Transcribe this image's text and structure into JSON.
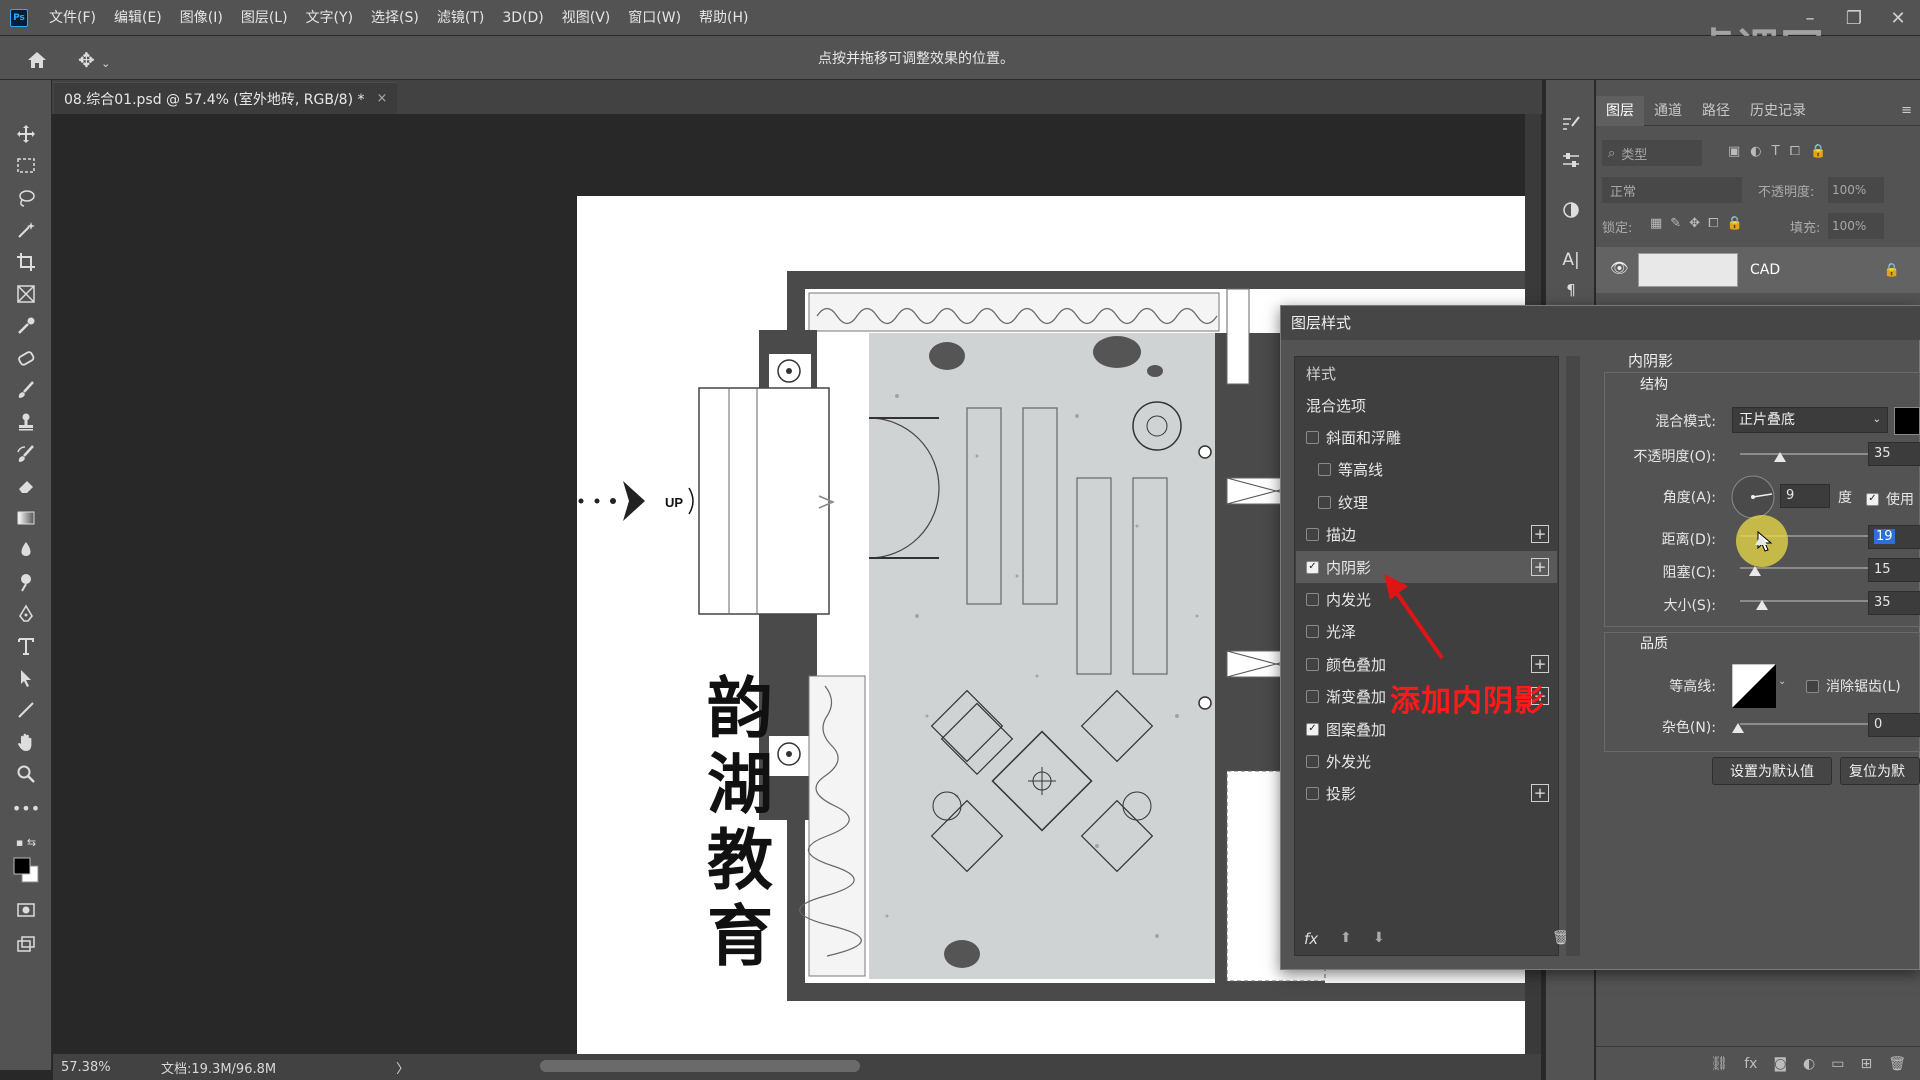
{
  "app": {
    "logo": "Ps"
  },
  "menu": [
    "文件(F)",
    "编辑(E)",
    "图像(I)",
    "图层(L)",
    "文字(Y)",
    "选择(S)",
    "滤镜(T)",
    "3D(D)",
    "视图(V)",
    "窗口(W)",
    "帮助(H)"
  ],
  "watermark": "虎课网",
  "options_bar": {
    "hint": "点按并拖移可调整效果的位置。"
  },
  "document": {
    "tab_title": "08.综合01.psd @ 57.4% (室外地砖, RGB/8) *",
    "close": "×"
  },
  "canvas": {
    "brand_text": "韵湖教育",
    "up_label": "UP"
  },
  "status": {
    "zoom": "57.38%",
    "doc_size": "文档:19.3M/96.8M",
    "arrow": "〉"
  },
  "layers_panel": {
    "tabs": [
      "图层",
      "通道",
      "路径",
      "历史记录"
    ],
    "active_tab": "图层",
    "filter_placeholder": "类型",
    "blend_mode": "正常",
    "opacity_label": "不透明度:",
    "opacity_value": "100%",
    "lock_label": "锁定:",
    "fill_label": "填充:",
    "fill_value": "100%",
    "layer_name": "CAD"
  },
  "dialog": {
    "title": "图层样式",
    "styles_header": "样式",
    "blend_options": "混合选项",
    "items": [
      {
        "label": "斜面和浮雕",
        "checked": false,
        "plus": false,
        "indent": false
      },
      {
        "label": "等高线",
        "checked": false,
        "plus": false,
        "indent": true
      },
      {
        "label": "纹理",
        "checked": false,
        "plus": false,
        "indent": true
      },
      {
        "label": "描边",
        "checked": false,
        "plus": true,
        "indent": false
      },
      {
        "label": "内阴影",
        "checked": true,
        "plus": true,
        "indent": false
      },
      {
        "label": "内发光",
        "checked": false,
        "plus": false,
        "indent": false
      },
      {
        "label": "光泽",
        "checked": false,
        "plus": false,
        "indent": false
      },
      {
        "label": "颜色叠加",
        "checked": false,
        "plus": true,
        "indent": false
      },
      {
        "label": "渐变叠加",
        "checked": false,
        "plus": true,
        "indent": false
      },
      {
        "label": "图案叠加",
        "checked": true,
        "plus": false,
        "indent": false
      },
      {
        "label": "外发光",
        "checked": false,
        "plus": false,
        "indent": false
      },
      {
        "label": "投影",
        "checked": false,
        "plus": true,
        "indent": false
      }
    ],
    "fx_label": "fx",
    "section_title": "内阴影",
    "structure_title": "结构",
    "blend_mode_label": "混合模式:",
    "blend_mode_value": "正片叠底",
    "opacity_label": "不透明度(O):",
    "opacity_value": "35",
    "angle_label": "角度(A):",
    "angle_value": "9",
    "angle_unit": "度",
    "use_global_label": "使用",
    "distance_label": "距离(D):",
    "distance_value": "19",
    "choke_label": "阻塞(C):",
    "choke_value": "15",
    "size_label": "大小(S):",
    "size_value": "35",
    "quality_title": "品质",
    "contour_label": "等高线:",
    "antialias_label": "消除锯齿(L)",
    "noise_label": "杂色(N):",
    "noise_value": "0",
    "default_button": "设置为默认值",
    "reset_button": "复位为默"
  },
  "annotation": "添加内阴影"
}
